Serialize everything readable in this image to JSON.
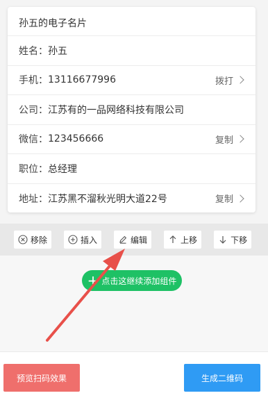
{
  "card": {
    "title": "孙五的电子名片",
    "rows": [
      {
        "label": "姓名：",
        "value": "孙五",
        "action": ""
      },
      {
        "label": "手机：",
        "value": "13116677996",
        "action": "拨打"
      },
      {
        "label": "公司：",
        "value": "江苏有的一品网络科技有限公司",
        "action": ""
      },
      {
        "label": "微信：",
        "value": "123456666",
        "action": "复制"
      },
      {
        "label": "职位：",
        "value": "总经理",
        "action": ""
      },
      {
        "label": "地址：",
        "value": "江苏黑不溜秋光明大道22号",
        "action": "复制"
      }
    ]
  },
  "toolbar": {
    "remove_label": "移除",
    "insert_label": "插入",
    "edit_label": "编辑",
    "up_label": "上移",
    "down_label": "下移"
  },
  "add_component_label": "点击这继续添加组件",
  "bottom": {
    "preview_label": "预览扫码效果",
    "generate_label": "生成二维码"
  },
  "colors": {
    "green": "#1ec165",
    "red": "#ef6f6c",
    "blue": "#2f9bf4",
    "arrow": "#e8504a"
  }
}
